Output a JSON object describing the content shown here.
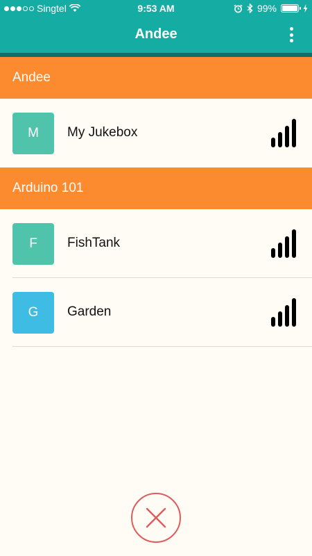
{
  "status_bar": {
    "carrier": "Singtel",
    "time": "9:53 AM",
    "battery_percent": "99%",
    "battery_level": 0.99,
    "signal_strength_dots_filled": 3,
    "signal_strength_dots_total": 5
  },
  "header": {
    "title": "Andee"
  },
  "groups": [
    {
      "name": "Andee",
      "devices": [
        {
          "initial": "M",
          "name": "My Jukebox",
          "color": "#4fc4aa",
          "signal_bars": 4
        }
      ]
    },
    {
      "name": "Arduino 101",
      "devices": [
        {
          "initial": "F",
          "name": "FishTank",
          "color": "#4fc4aa",
          "signal_bars": 4
        },
        {
          "initial": "G",
          "name": "Garden",
          "color": "#3fbce3",
          "signal_bars": 4
        }
      ]
    }
  ],
  "colors": {
    "header_bg": "#15aca3",
    "section_bg": "#fc8a2f",
    "page_bg": "#fefcf5",
    "close_accent": "#e05b5b"
  },
  "icons": {
    "menu": "more-vertical-icon",
    "signal": "signal-strength-icon",
    "close": "close-icon",
    "wifi": "wifi-icon",
    "alarm": "alarm-icon",
    "bluetooth": "bluetooth-icon",
    "battery": "battery-icon",
    "charging": "charging-bolt-icon"
  }
}
